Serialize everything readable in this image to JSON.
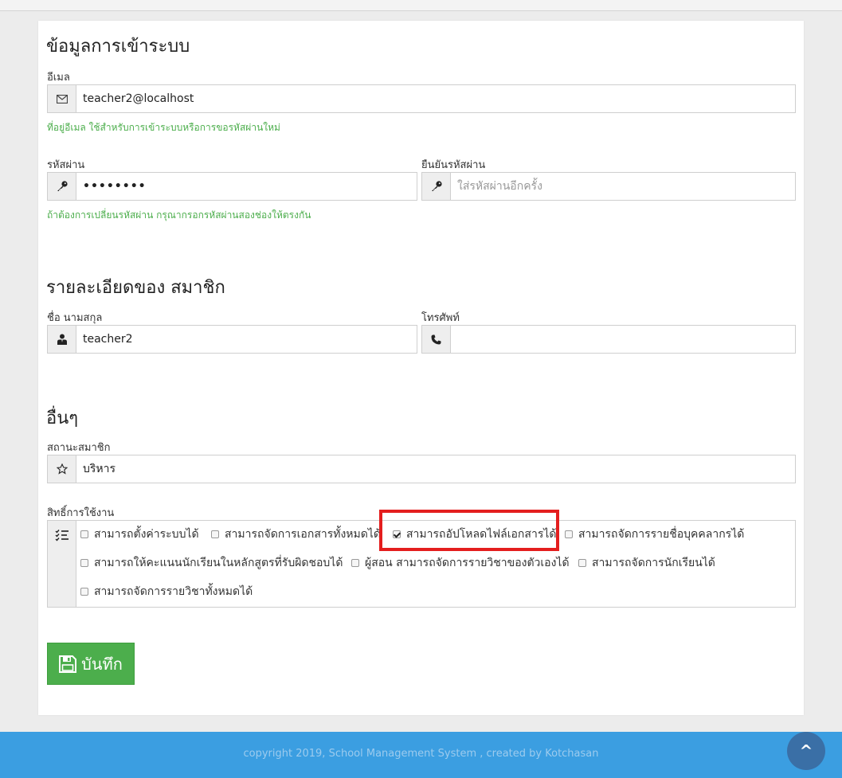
{
  "login_section": {
    "title": "ข้อมูลการเข้าระบบ",
    "email_label": "อีเมล",
    "email_value": "teacher2@localhost",
    "email_help": "ที่อยู่อีเมล ใช้สำหรับการเข้าระบบหรือการขอรหัสผ่านใหม่",
    "password_label": "รหัสผ่าน",
    "password_value": "••••••••",
    "confirm_label": "ยืนยันรหัสผ่าน",
    "confirm_placeholder": "ใส่รหัสผ่านอีกครั้ง",
    "password_help": "ถ้าต้องการเปลี่ยนรหัสผ่าน กรุณากรอกรหัสผ่านสองช่องให้ตรงกัน"
  },
  "member_section": {
    "title": "รายละเอียดของ สมาชิก",
    "name_label": "ชื่อ นามสกุล",
    "name_value": "teacher2",
    "phone_label": "โทรศัพท์",
    "phone_value": ""
  },
  "other_section": {
    "title": "อื่นๆ",
    "status_label": "สถานะสมาชิก",
    "status_value": "บริหาร",
    "permissions_label": "สิทธิ์การใช้งาน",
    "permissions": [
      {
        "label": "สามารถตั้งค่าระบบได้",
        "checked": false
      },
      {
        "label": "สามารถจัดการเอกสารทั้งหมดได้",
        "checked": false
      },
      {
        "label": "สามารถอัปโหลดไฟล์เอกสารได้",
        "checked": true
      },
      {
        "label": "สามารถจัดการรายชื่อบุคคลากรได้",
        "checked": false
      },
      {
        "label": "สามารถให้คะแนนนักเรียนในหลักสูตรที่รับผิดชอบได้",
        "checked": false
      },
      {
        "label": "ผู้สอน สามารถจัดการรายวิชาของตัวเองได้",
        "checked": false
      },
      {
        "label": "สามารถจัดการนักเรียนได้",
        "checked": false
      },
      {
        "label": "สามารถจัดการรายวิชาทั้งหมดได้",
        "checked": false
      }
    ]
  },
  "save_button": "บันทึก",
  "footer": {
    "text": "copyright 2019, School Management System , created by Kotchasan",
    "back_to_top": "^"
  },
  "colors": {
    "accent_green": "#4cae4c",
    "footer_blue": "#3b9ee1",
    "highlight_red": "#e41e1e"
  }
}
